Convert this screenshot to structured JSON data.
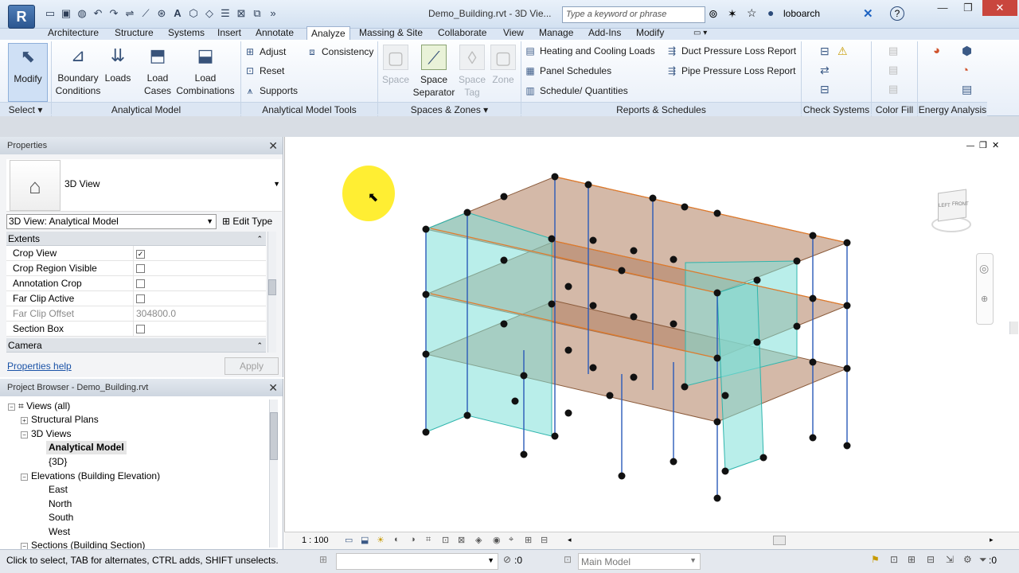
{
  "app": {
    "logo": "R",
    "doc_title": "Demo_Building.rvt - 3D Vie...",
    "search_placeholder": "Type a keyword or phrase",
    "user": "loboarch",
    "help": "?"
  },
  "icons": {
    "open": "folder-open-icon",
    "save": "save-icon",
    "undo": "undo-icon",
    "redo": "redo-icon",
    "measure": "measure-icon",
    "text": "text-icon"
  },
  "tabs": [
    "Architecture",
    "Structure",
    "Systems",
    "Insert",
    "Annotate",
    "Analyze",
    "Massing & Site",
    "Collaborate",
    "View",
    "Manage",
    "Add-Ins",
    "Modify"
  ],
  "active_tab": "Analyze",
  "ribbon": {
    "modify": "Modify",
    "boundary": [
      "Boundary",
      "Conditions"
    ],
    "loads": "Loads",
    "load_cases": [
      "Load",
      "Cases"
    ],
    "load_combinations": [
      "Load",
      "Combinations"
    ],
    "adjust": "Adjust",
    "consistency": "Consistency",
    "reset": "Reset",
    "supports": "Supports",
    "space": "Space",
    "space_separator": [
      "Space",
      "Separator"
    ],
    "space_tag": [
      "Space",
      "Tag"
    ],
    "zone": "Zone",
    "heating": "Heating and  Cooling Loads",
    "panel_schedules": "Panel  Schedules",
    "schedule_quantities": "Schedule/  Quantities",
    "duct_pressure": "Duct Pressure  Loss Report",
    "pipe_pressure": "Pipe Pressure  Loss Report",
    "panels": {
      "select": "Select",
      "analytical_model": "Analytical Model",
      "analytical_tools": "Analytical Model Tools",
      "spaces_zones": "Spaces & Zones",
      "reports": "Reports & Schedules",
      "check_systems": "Check Systems",
      "color_fill": "Color Fill",
      "energy": "Energy Analysis"
    }
  },
  "properties": {
    "title": "Properties",
    "type_name": "3D View",
    "instance": "3D View: Analytical Model",
    "edit_type": "Edit Type",
    "group_extents": "Extents",
    "rows": [
      {
        "label": "Crop View",
        "checked": true
      },
      {
        "label": "Crop Region Visible",
        "checked": false
      },
      {
        "label": "Annotation Crop",
        "checked": false
      },
      {
        "label": "Far Clip Active",
        "checked": false
      },
      {
        "label": "Far Clip Offset",
        "value": "304800.0"
      },
      {
        "label": "Section Box",
        "checked": false
      }
    ],
    "group_camera": "Camera",
    "help": "Properties help",
    "apply": "Apply"
  },
  "browser": {
    "title": "Project Browser - Demo_Building.rvt",
    "views_all": "Views (all)",
    "structural_plans": "Structural Plans",
    "views_3d": "3D Views",
    "analytical_model": "Analytical Model",
    "view_3d": "{3D}",
    "elevations": "Elevations (Building Elevation)",
    "east": "East",
    "north": "North",
    "south": "South",
    "west": "West",
    "sections": "Sections (Building Section)"
  },
  "viewcube": {
    "left": "LEFT",
    "front": "FRONT"
  },
  "viewbar": {
    "scale": "1 : 100"
  },
  "status": {
    "hint": "Click to select, TAB for alternates, CTRL adds, SHIFT unselects.",
    "zero": ":0",
    "model": "Main Model",
    "filter": ":0"
  }
}
